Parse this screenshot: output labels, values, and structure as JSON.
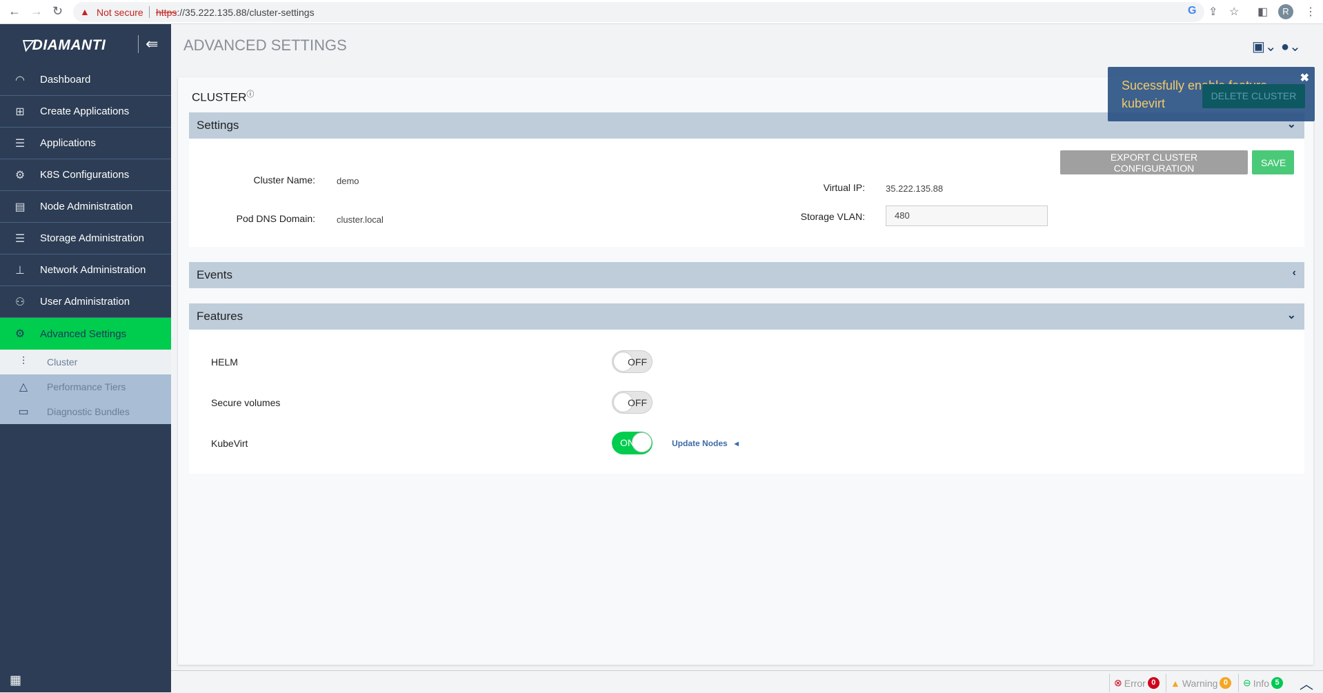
{
  "browser": {
    "not_secure": "Not secure",
    "url_scheme": "https",
    "url_rest": "://35.222.135.88/cluster-settings",
    "profile_initial": "R"
  },
  "sidebar": {
    "logo": "DIAMANTI",
    "items": [
      {
        "label": "Dashboard",
        "icon": "gauge-icon"
      },
      {
        "label": "Create Applications",
        "icon": "plus-square-icon"
      },
      {
        "label": "Applications",
        "icon": "list-icon"
      },
      {
        "label": "K8S Configurations",
        "icon": "gear-icon"
      },
      {
        "label": "Node Administration",
        "icon": "server-icon"
      },
      {
        "label": "Storage Administration",
        "icon": "database-icon"
      },
      {
        "label": "Network Administration",
        "icon": "network-icon"
      },
      {
        "label": "User Administration",
        "icon": "users-icon"
      },
      {
        "label": "Advanced Settings",
        "icon": "cogs-icon",
        "active": true
      }
    ],
    "subitems": [
      {
        "label": "Cluster",
        "icon": "sliders-icon",
        "selected": true
      },
      {
        "label": "Performance Tiers",
        "icon": "pyramid-icon"
      },
      {
        "label": "Diagnostic Bundles",
        "icon": "monitor-icon"
      }
    ]
  },
  "header": {
    "title": "ADVANCED SETTINGS"
  },
  "card": {
    "title": "CLUSTER",
    "help": "?",
    "delete_button": "DELETE CLUSTER"
  },
  "settings": {
    "title": "Settings",
    "cluster_name_label": "Cluster Name:",
    "cluster_name": "demo",
    "pod_dns_label": "Pod DNS Domain:",
    "pod_dns": "cluster.local",
    "virtual_ip_label": "Virtual IP:",
    "virtual_ip": "35.222.135.88",
    "storage_vlan_label": "Storage VLAN:",
    "storage_vlan": "480",
    "export_button": "EXPORT CLUSTER CONFIGURATION",
    "save_button": "SAVE"
  },
  "events": {
    "title": "Events"
  },
  "features": {
    "title": "Features",
    "items": [
      {
        "label": "HELM",
        "state": "OFF"
      },
      {
        "label": "Secure volumes",
        "state": "OFF"
      },
      {
        "label": "KubeVirt",
        "state": "ON"
      }
    ],
    "update_nodes": "Update Nodes"
  },
  "toast": {
    "message": "Sucessfully enable feature kubevirt"
  },
  "status": {
    "error_label": "Error",
    "error_count": "0",
    "warning_label": "Warning",
    "warning_count": "0",
    "info_label": "Info",
    "info_count": "5"
  },
  "colors": {
    "sidebar": "#2c3d55",
    "active": "#00cc4e",
    "panel_header": "#bfcddb",
    "save": "#4ac979",
    "export": "#a0a0a0"
  }
}
